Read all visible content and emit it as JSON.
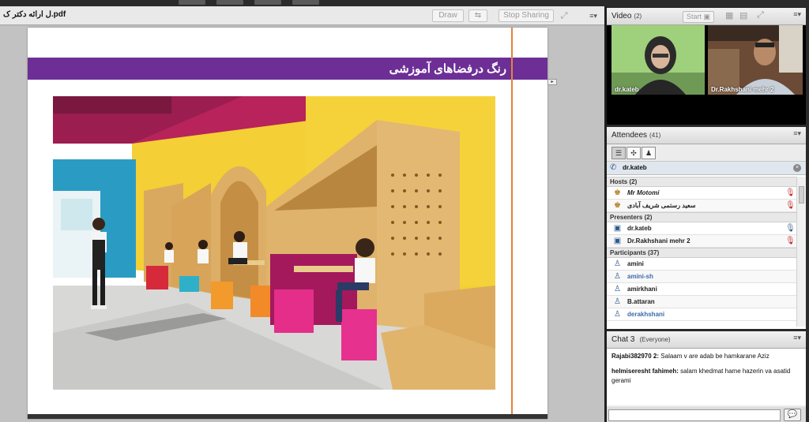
{
  "topbar": {
    "buttons": [
      "",
      "",
      "",
      ""
    ]
  },
  "share": {
    "title": "ل ارائه دکتر ک.pdf",
    "draw_label": "Draw",
    "stop_sharing_label": "Stop Sharing",
    "slide_title": "رنگ درفضاهای آموزشی"
  },
  "video": {
    "title": "Video",
    "count": "(2)",
    "start_label": "Start",
    "tiles": [
      {
        "name": "dr.kateb"
      },
      {
        "name": "Dr.Rakhshani mehr 2"
      }
    ]
  },
  "attendees": {
    "title": "Attendees",
    "count": "(41)",
    "me": "dr.kateb",
    "groups": {
      "hosts": "Hosts (2)",
      "presenters": "Presenters (2)",
      "participants": "Participants (37)"
    },
    "hosts": [
      "Mr Motomi",
      "سعید رستمی شریف آبادی"
    ],
    "presenters": [
      "dr.kateb",
      "Dr.Rakhshani mehr 2"
    ],
    "participants": [
      "amini",
      "amini-sh",
      "amirkhani",
      "B.attaran",
      "derakhshani"
    ]
  },
  "chat": {
    "title": "Chat 3",
    "scope": "(Everyone)",
    "messages": [
      {
        "sender": "Rajabi382970 2:",
        "text": "Salaam v are adab be hamkarane Aziz"
      },
      {
        "sender": "helmiseresht fahimeh:",
        "text": "salam khedmat hame hazerin va asatid gerami"
      }
    ],
    "input_value": ""
  },
  "colors": {
    "slide_band": "#6d2f96",
    "accent_line": "#e3843a"
  }
}
